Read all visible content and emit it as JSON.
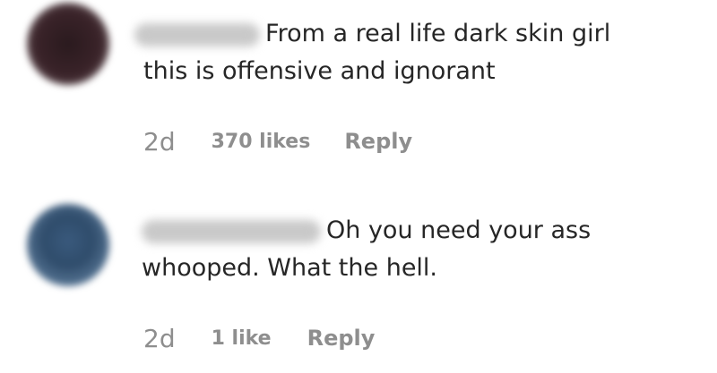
{
  "comments": [
    {
      "text_line_1": "From a real life dark skin girl",
      "text_line_2": "this is offensive and ignorant",
      "time": "2d",
      "likes": "370 likes",
      "reply_label": "Reply"
    },
    {
      "text_line_1": "Oh you need your ass",
      "text_line_2": "whooped. What the hell.",
      "time": "2d",
      "likes": "1 like",
      "reply_label": "Reply"
    }
  ]
}
